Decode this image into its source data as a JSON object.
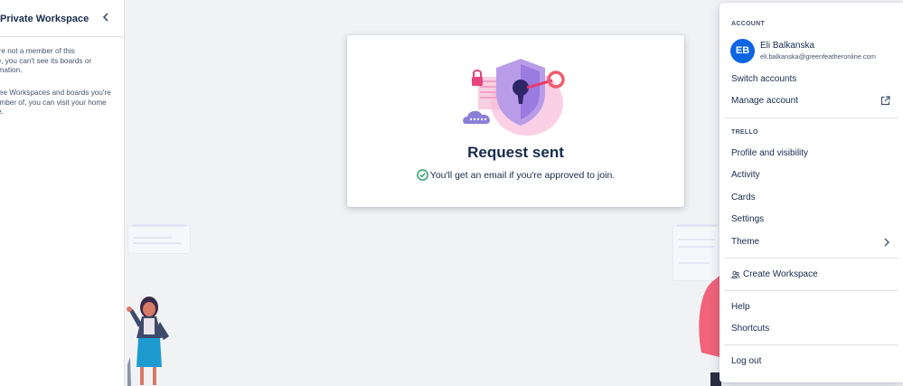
{
  "sidebar": {
    "title": "Private Workspace",
    "paragraph1": [
      "ou're not a member of this",
      "ace, you can't see its boards or",
      "formation."
    ],
    "paragraph2": [
      "o see Workspaces and boards you're",
      "member of, you can visit your home",
      "age."
    ]
  },
  "card": {
    "title": "Request sent",
    "subtitle": "You'll get an email if you're approved to join."
  },
  "menu": {
    "account_section": "ACCOUNT",
    "avatar_initials": "EB",
    "user_name": "Eli Balkanska",
    "user_email": "eli.balkanska@greenfeatheronline.com",
    "switch_accounts": "Switch accounts",
    "manage_account": "Manage account",
    "trello_section": "TRELLO",
    "profile": "Profile and visibility",
    "activity": "Activity",
    "cards": "Cards",
    "settings": "Settings",
    "theme": "Theme",
    "create_workspace": "Create Workspace",
    "help": "Help",
    "shortcuts": "Shortcuts",
    "logout": "Log out"
  },
  "colors": {
    "accent": "#0c66e4",
    "success": "#22a06b",
    "text": "#172b4d"
  }
}
